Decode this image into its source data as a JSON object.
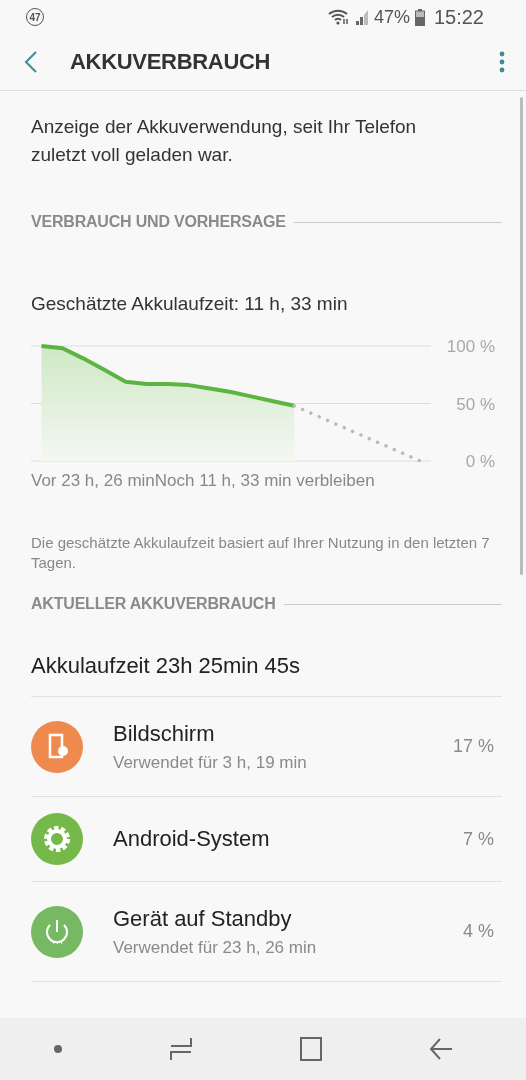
{
  "status_bar": {
    "notification_count": "47",
    "battery": "47%",
    "time": "15:22"
  },
  "app_bar": {
    "title": "AKKUVERBRAUCH"
  },
  "description": "Anzeige der Akkuverwendung, seit Ihr Telefon zuletzt voll geladen war.",
  "usage_section": {
    "header": "VERBRAUCH UND VORHERSAGE",
    "estimate": "Geschätzte Akkulaufzeit: 11 h, 33 min",
    "chart_data": {
      "type": "area",
      "categories": [
        null,
        null,
        null,
        null,
        null,
        null,
        null,
        null,
        null,
        null,
        null,
        null,
        null,
        null,
        null,
        null,
        null,
        null,
        null
      ],
      "series": [
        {
          "color": "#5cb443",
          "values": [
            100,
            98,
            89,
            79,
            69,
            67,
            67,
            66,
            63,
            60,
            56,
            52,
            48,
            null,
            null,
            null,
            null,
            null,
            null
          ]
        },
        {
          "color": "#b8b8c0",
          "type": "line",
          "line_style": "dotted",
          "values": [
            null,
            null,
            null,
            null,
            null,
            null,
            null,
            null,
            null,
            null,
            null,
            null,
            48,
            40,
            32,
            24,
            16,
            8,
            0
          ]
        }
      ],
      "ylim": [
        0,
        100
      ],
      "yticks": [
        {
          "value": 100,
          "label": "100 %"
        },
        {
          "value": 50,
          "label": "50 %"
        },
        {
          "value": 0,
          "label": "0 %"
        }
      ]
    },
    "x_start_label": "Vor 23 h, 26 min",
    "x_end_label": "Noch 11 h, 33 min verbleiben",
    "note": "Die geschätzte Akkulaufzeit basiert auf Ihrer Nutzung in den letzten 7 Tagen."
  },
  "current_section": {
    "header": "AKTUELLER AKKUVERBRAUCH",
    "runtime": "Akkulaufzeit 23h 25min 45s",
    "items": [
      {
        "kind": "display",
        "color": "#ef8a4f",
        "name": "Bildschirm",
        "detail": "Verwendet für 3 h, 19 min",
        "percent": "17 %"
      },
      {
        "kind": "system",
        "color": "#75b94a",
        "name": "Android-System",
        "percent": "7 %"
      },
      {
        "kind": "standby",
        "color": "#77b862",
        "name": "Gerät auf Standby",
        "detail": "Verwendet für 23 h, 26 min",
        "percent": "4 %"
      }
    ]
  }
}
